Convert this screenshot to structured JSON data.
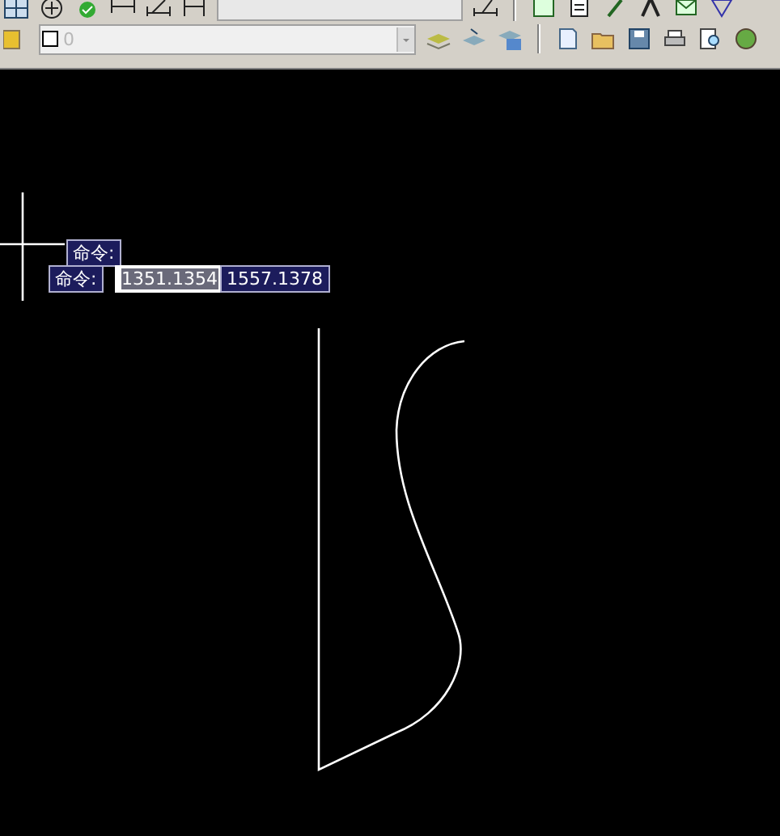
{
  "layer_field": {
    "value": "0"
  },
  "canvas": {
    "prompt_tooltip": "命令:",
    "input_prompt": "命令:",
    "fields": [
      {
        "value": "1351.1354",
        "selected": true
      },
      {
        "value": "1557.1378",
        "selected": false
      }
    ]
  }
}
